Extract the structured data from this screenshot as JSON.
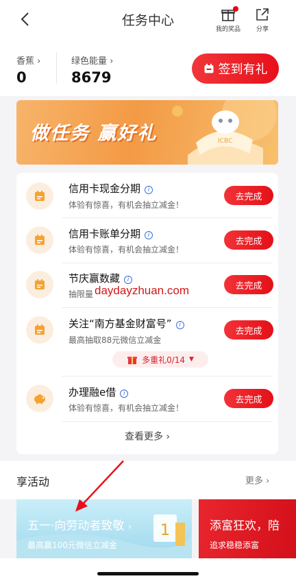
{
  "header": {
    "title": "任务中心",
    "my_prizes_label": "我的奖品",
    "share_label": "分享"
  },
  "stats": {
    "banana_label": "香蕉",
    "banana_value": "0",
    "energy_label": "绿色能量",
    "energy_value": "8679",
    "sign_in_label": "签到有礼"
  },
  "banner": {
    "text": "做任务 赢好礼",
    "logo_text": "ICBC"
  },
  "tasks": [
    {
      "title": "信用卡现金分期",
      "desc": "体验有惊喜，有机会抽立减金！",
      "button": "去完成",
      "icon": "calendar-icon"
    },
    {
      "title": "信用卡账单分期",
      "desc": "体验有惊喜，有机会抽立减金！",
      "button": "去完成",
      "icon": "calendar-icon"
    },
    {
      "title": "节庆赢数藏",
      "desc": "抽限量",
      "button": "去完成",
      "icon": "calendar-icon"
    },
    {
      "title": "关注“南方基金财富号”",
      "desc": "最高抽取88元微信立减金",
      "button": "去完成",
      "icon": "calendar-icon"
    },
    {
      "title": "办理融e借",
      "desc": "体验有惊喜，有机会抽立减金！",
      "button": "去完成",
      "icon": "piggy-bank-icon"
    }
  ],
  "multi_gift": "多重礼0/14",
  "see_more": "查看更多",
  "activities": {
    "title": "享活动",
    "more": "更多",
    "promos": [
      {
        "title": "五一·向劳动者致敬",
        "subtitle": "最高赢100元微信立减金"
      },
      {
        "title": "添富狂欢，陪",
        "subtitle": "追求稳稳添富"
      }
    ]
  },
  "watermark": "daydayzhuan.com",
  "colors": {
    "accent": "#e8101a",
    "banner": "#f39a45"
  }
}
